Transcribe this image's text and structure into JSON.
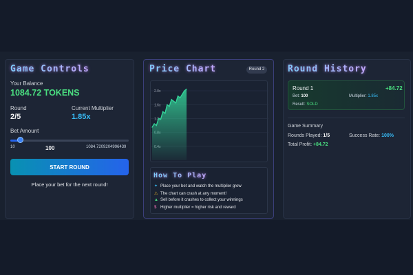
{
  "controls": {
    "title": "Game Controls",
    "balance_label": "Your Balance",
    "balance_value": "1084.72 TOKENS",
    "round_label": "Round",
    "round_value": "2/5",
    "multiplier_label": "Current Multiplier",
    "multiplier_value": "1.85x",
    "bet_label": "Bet Amount",
    "bet_min": "10",
    "bet_value": "100",
    "bet_max": "1084.7209204996439",
    "bet_fraction": 0.083,
    "start_button": "START ROUND",
    "hint": "Place your bet for the next round!"
  },
  "chart": {
    "title": "Price Chart",
    "round_badge": "Round 2",
    "chart_data": {
      "type": "area",
      "y_ticks": [
        "2.0x",
        "1.6x",
        "1.2x",
        "0.8x",
        "0.4x"
      ],
      "ylim": [
        0,
        2.2
      ],
      "x": [
        0,
        1,
        2,
        3,
        4,
        5,
        6,
        7,
        8,
        9,
        10,
        11,
        12,
        13,
        14,
        15,
        16
      ],
      "values": [
        0.95,
        1.05,
        1.0,
        1.2,
        1.18,
        1.4,
        1.35,
        1.6,
        1.55,
        1.75,
        1.7,
        1.65,
        1.85,
        1.8,
        1.9,
        2.0,
        2.05
      ],
      "color": "#34d399"
    },
    "howto": {
      "title": "How To Play",
      "items": [
        {
          "icon": "sparkle-icon",
          "glyph": "✦",
          "color": "#38bdf8",
          "text": "Place your bet and watch the multiplier grow"
        },
        {
          "icon": "warning-icon",
          "glyph": "⚠",
          "color": "#fbbf24",
          "text": "The chart can crash at any moment!"
        },
        {
          "icon": "trend-icon",
          "glyph": "▲",
          "color": "#4ade80",
          "text": "Sell before it crashes to collect your winnings"
        },
        {
          "icon": "dollar-icon",
          "glyph": "$",
          "color": "#f472b6",
          "text": "Higher multiplier = higher risk and reward"
        }
      ]
    }
  },
  "history": {
    "title": "Round History",
    "round": {
      "name": "Round 1",
      "profit": "+84.72",
      "bet_label": "Bet:",
      "bet_value": "100",
      "mult_label": "Multiplier:",
      "mult_value": "1.85x",
      "result_label": "Result:",
      "result_value": "SOLD"
    },
    "summary": {
      "title": "Game Summary",
      "played_label": "Rounds Played:",
      "played_value": "1/5",
      "success_label": "Success Rate:",
      "success_value": "100%",
      "profit_label": "Total Profit:",
      "profit_value": "+84.72"
    }
  }
}
